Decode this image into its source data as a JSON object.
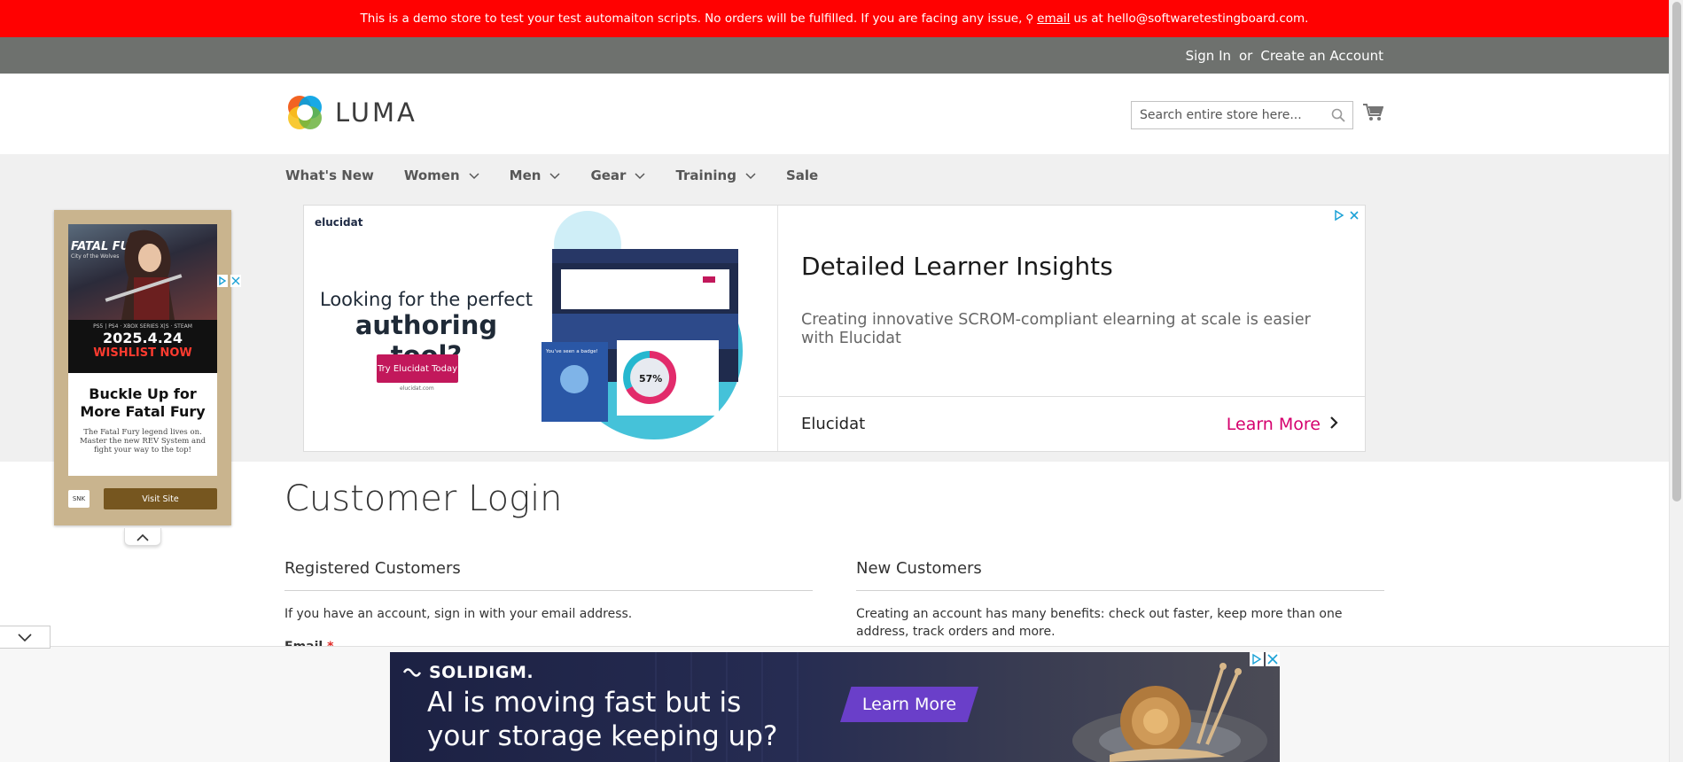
{
  "demo_banner": {
    "text_before": "This is a demo store to test your test automaiton scripts. No orders will be fulfilled. If you are facing any issue,",
    "link": "email",
    "text_after": "us at hello@softwaretestingboard.com."
  },
  "top_bar": {
    "sign_in": "Sign In",
    "or": "or",
    "create_account": "Create an Account"
  },
  "header": {
    "logo_text": "LUMA",
    "search_placeholder": "Search entire store here..."
  },
  "nav": {
    "items": [
      {
        "label": "What's New",
        "has_dropdown": false
      },
      {
        "label": "Women",
        "has_dropdown": true
      },
      {
        "label": "Men",
        "has_dropdown": true
      },
      {
        "label": "Gear",
        "has_dropdown": true
      },
      {
        "label": "Training",
        "has_dropdown": true
      },
      {
        "label": "Sale",
        "has_dropdown": false
      }
    ]
  },
  "ad_main": {
    "brand": "elucidat",
    "headline_1": "Looking for the perfect",
    "headline_2": "authoring tool?",
    "cta": "Try Elucidat Today",
    "url": "elucidat.com",
    "badge_text": "You've seen a badge!",
    "percent": "57%",
    "title": "Detailed Learner Insights",
    "description": "Creating innovative SCROM-compliant elearning at scale is easier with Elucidat",
    "advertiser": "Elucidat",
    "learn_more": "Learn More"
  },
  "side_ad": {
    "game_title": "FATAL FURY",
    "game_subtitle": "City of the Wolves",
    "platforms": "PS5 | PS4 · XBOX SERIES X|S · STEAM",
    "date": "2025.4.24",
    "wishlist": "WISHLIST NOW",
    "headline": "Buckle Up for More Fatal Fury",
    "body": "The Fatal Fury legend lives on. Master the new REV System and fight your way to the top!",
    "logo": "SNK",
    "visit": "Visit Site"
  },
  "main": {
    "page_title": "Customer Login",
    "registered_title": "Registered Customers",
    "registered_text": "If you have an account, sign in with your email address.",
    "email_label": "Email",
    "required_mark": "*",
    "new_title": "New Customers",
    "new_text": "Creating an account has many benefits: check out faster, keep more than one address, track orders and more."
  },
  "anchor_ad": {
    "brand": "SOLIDIGM.",
    "line1": "AI is moving fast but is",
    "line2": "your storage keeping up?",
    "learn_more": "Learn More"
  },
  "colors": {
    "demo_banner": "#ff0101",
    "top_bar": "#6e716e",
    "nav_bg": "#f0f0f0",
    "ad_accent": "#c2185b",
    "learn_more": "#d5006d",
    "anchor_cta": "#6a3fc9"
  }
}
